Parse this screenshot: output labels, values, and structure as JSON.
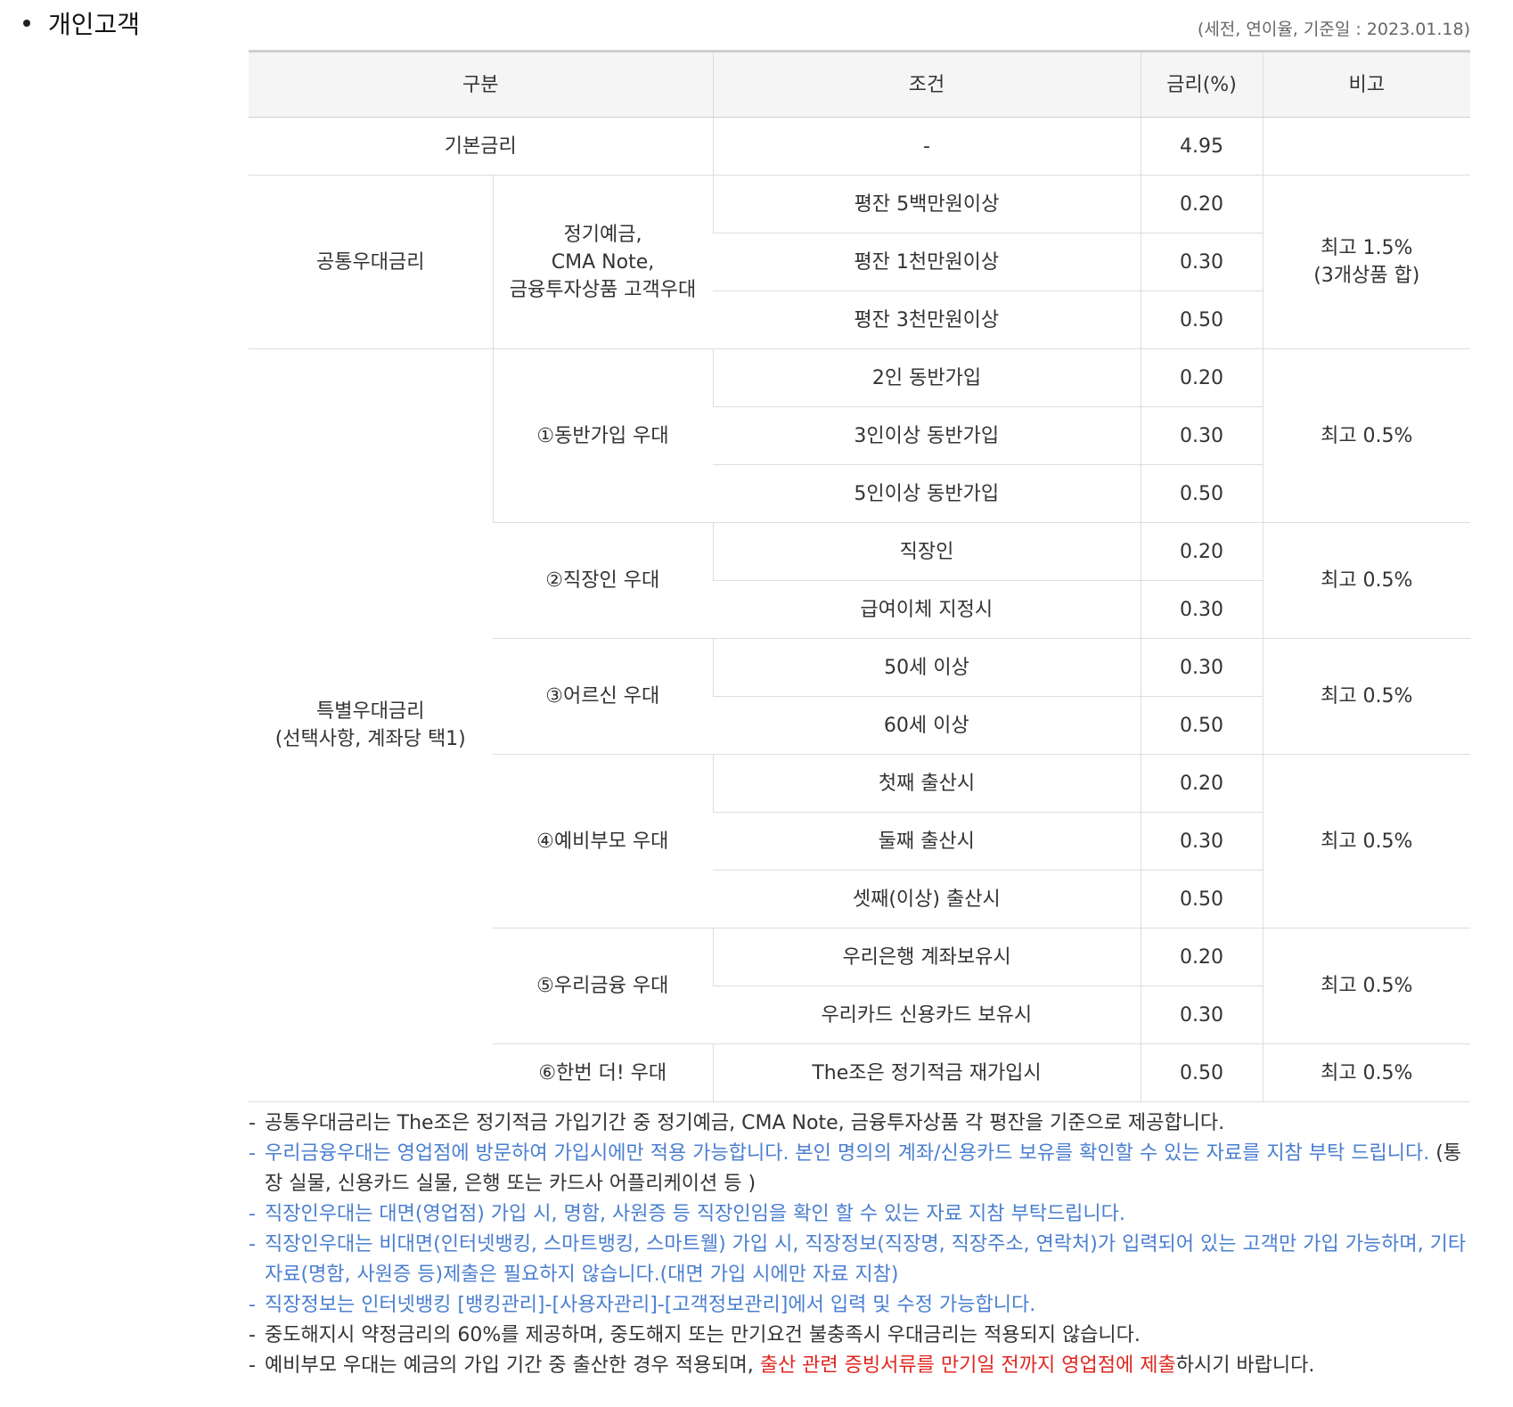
{
  "section": {
    "title": "개인고객"
  },
  "meta_note": "(세전, 연이율, 기준일 : 2023.01.18)",
  "table": {
    "headers": {
      "category": "구분",
      "condition": "조건",
      "rate": "금리(%)",
      "remark": "비고"
    },
    "basic": {
      "label": "기본금리",
      "condition": "-",
      "rate": "4.95"
    },
    "common": {
      "label": "공통우대금리",
      "sub_label": "정기예금,\nCMA Note,\n금융투자상품 고객우대",
      "rows": [
        {
          "condition": "평잔 5백만원이상",
          "rate": "0.20"
        },
        {
          "condition": "평잔 1천만원이상",
          "rate": "0.30"
        },
        {
          "condition": "평잔 3천만원이상",
          "rate": "0.50"
        }
      ],
      "remark": "최고 1.5%\n(3개상품 합)"
    },
    "special": {
      "label": "특별우대금리\n(선택사항, 계좌당 택1)",
      "groups": [
        {
          "label": "①동반가입 우대",
          "remark": "최고 0.5%",
          "rows": [
            {
              "condition": "2인 동반가입",
              "rate": "0.20"
            },
            {
              "condition": "3인이상 동반가입",
              "rate": "0.30"
            },
            {
              "condition": "5인이상 동반가입",
              "rate": "0.50"
            }
          ]
        },
        {
          "label": "②직장인 우대",
          "remark": "최고 0.5%",
          "rows": [
            {
              "condition": "직장인",
              "rate": "0.20"
            },
            {
              "condition": "급여이체 지정시",
              "rate": "0.30"
            }
          ]
        },
        {
          "label": "③어르신 우대",
          "remark": "최고 0.5%",
          "rows": [
            {
              "condition": "50세 이상",
              "rate": "0.30"
            },
            {
              "condition": "60세 이상",
              "rate": "0.50"
            }
          ]
        },
        {
          "label": "④예비부모 우대",
          "remark": "최고 0.5%",
          "rows": [
            {
              "condition": "첫째 출산시",
              "rate": "0.20"
            },
            {
              "condition": "둘째 출산시",
              "rate": "0.30"
            },
            {
              "condition": "셋째(이상) 출산시",
              "rate": "0.50"
            }
          ]
        },
        {
          "label": "⑤우리금융 우대",
          "remark": "최고 0.5%",
          "rows": [
            {
              "condition": "우리은행 계좌보유시",
              "rate": "0.20"
            },
            {
              "condition": "우리카드 신용카드 보유시",
              "rate": "0.30"
            }
          ]
        },
        {
          "label": "⑥한번 더! 우대",
          "remark": "최고 0.5%",
          "rows": [
            {
              "condition": "The조은 정기적금 재가입시",
              "rate": "0.50"
            }
          ]
        }
      ]
    }
  },
  "notes": {
    "dash": "-",
    "n1": "공통우대금리는 The조은 정기적금 가입기간 중 정기예금, CMA Note, 금융투자상품 각 평잔을 기준으로 제공합니다.",
    "n2_blue": "우리금융우대는 영업점에 방문하여 가입시에만 적용 가능합니다. 본인 명의의 계좌/신용카드 보유를 확인할 수 있는 자료를 지참 부탁 드립니다.",
    "n2_tail": " (통장 실물, 신용카드 실물, 은행 또는 카드사 어플리케이션 등 )",
    "n3": "직장인우대는 대면(영업점) 가입 시, 명함, 사원증 등 직장인임을 확인 할 수 있는 자료 지참 부탁드립니다.",
    "n4": "직장인우대는 비대면(인터넷뱅킹, 스마트뱅킹, 스마트웰) 가입 시, 직장정보(직장명, 직장주소, 연락처)가 입력되어 있는 고객만 가입 가능하며, 기타 자료(명함, 사원증 등)제출은 필요하지 않습니다.(대면 가입 시에만 자료 지참)",
    "n5": "직장정보는 인터넷뱅킹 [뱅킹관리]-[사용자관리]-[고객정보관리]에서 입력 및 수정 가능합니다.",
    "n6": "중도해지시 약정금리의 60%를 제공하며, 중도해지 또는 만기요건 불충족시 우대금리는 적용되지 않습니다.",
    "n7_pre": "예비부모 우대는 예금의 가입 기간 중 출산한 경우 적용되며, ",
    "n7_red": "출산 관련 증빙서류를 만기일 전까지 영업점에 제출",
    "n7_post": "하시기 바랍니다."
  },
  "colors": {
    "blue_note": "#4a7fd0",
    "red_emphasis": "#e0261f",
    "header_bg": "#f5f5f5"
  }
}
